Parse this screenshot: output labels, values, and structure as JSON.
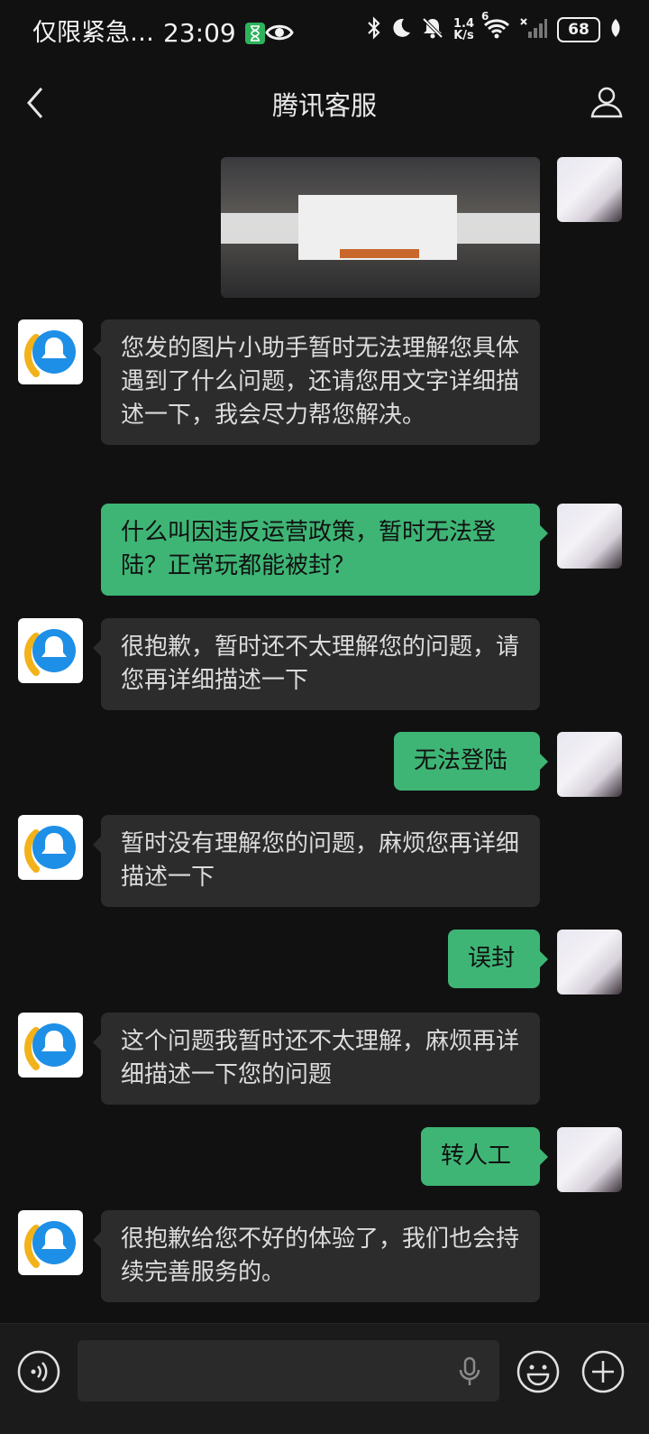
{
  "status_bar": {
    "carrier": "仅限紧急…",
    "time": "23:09",
    "net_speed_value": "1.4",
    "net_speed_unit": "K/s",
    "signal_label": "6",
    "battery": "68"
  },
  "nav": {
    "title": "腾讯客服"
  },
  "messages": [
    {
      "from": "bot",
      "text": "您发的图片小助手暂时无法理解您具体遇到了什么问题，还请您用文字详细描述一下，我会尽力帮您解决。"
    },
    {
      "from": "user",
      "text": "什么叫因违反运营政策，暂时无法登陆？正常玩都能被封？"
    },
    {
      "from": "bot",
      "text": "很抱歉，暂时还不太理解您的问题，请您再详细描述一下"
    },
    {
      "from": "user",
      "text": "无法登陆"
    },
    {
      "from": "bot",
      "text": "暂时没有理解您的问题，麻烦您再详细描述一下"
    },
    {
      "from": "user",
      "text": "误封"
    },
    {
      "from": "bot",
      "text": "这个问题我暂时还不太理解，麻烦再详细描述一下您的问题"
    },
    {
      "from": "user",
      "text": "转人工"
    },
    {
      "from": "bot",
      "text": "很抱歉给您不好的体验了，我们也会持续完善服务的。"
    }
  ],
  "icons": {
    "back": "chevron-left-icon",
    "profile": "person-icon",
    "voice": "voice-icon",
    "mic": "microphone-icon",
    "emoji": "emoji-icon",
    "more": "plus-icon"
  },
  "colors": {
    "background": "#111111",
    "incoming_bubble": "#2c2c2c",
    "outgoing_bubble": "#3eb575",
    "bot_avatar_blue": "#1e8fe6",
    "bot_avatar_yellow": "#f2b21a"
  }
}
